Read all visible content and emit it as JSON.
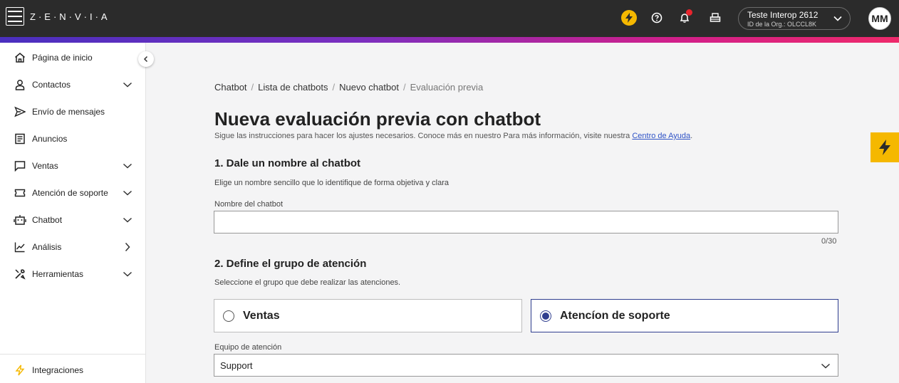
{
  "brand": {
    "logo_text": "Z·E·N·V·I·A"
  },
  "header": {
    "org_name": "Teste Interop 2612",
    "org_id": "ID de la Org.: OLCCL8K",
    "avatar_initials": "MM",
    "icons": [
      "bolt-icon",
      "help-icon",
      "bell-icon",
      "inbox-icon",
      "chevron-down-icon"
    ],
    "accent": "#f5b800",
    "notif_color": "#e8242d"
  },
  "sidebar": {
    "items": [
      {
        "label": "Página de inicio",
        "icon": "home-icon",
        "chevron": ""
      },
      {
        "label": "Contactos",
        "icon": "person-icon",
        "chevron": "down"
      },
      {
        "label": "Envío de mensajes",
        "icon": "send-icon",
        "chevron": ""
      },
      {
        "label": "Anuncios",
        "icon": "megaphone-icon",
        "chevron": ""
      },
      {
        "label": "Ventas",
        "icon": "chat-icon",
        "chevron": "down"
      },
      {
        "label": "Atención de soporte",
        "icon": "ticket-icon",
        "chevron": "down"
      },
      {
        "label": "Chatbot",
        "icon": "robot-icon",
        "chevron": "down"
      },
      {
        "label": "Análisis",
        "icon": "chart-icon",
        "chevron": "right"
      },
      {
        "label": "Herramientas",
        "icon": "tools-icon",
        "chevron": "down"
      }
    ],
    "footer_item": {
      "label": "Integraciones",
      "icon": "bolt-icon"
    }
  },
  "breadcrumb": [
    "Chatbot",
    "Lista de chatbots",
    "Nuevo chatbot",
    "Evaluación previa"
  ],
  "page": {
    "title": "Nueva evaluación previa con chatbot",
    "subtitle": "Sigue las instrucciones para hacer los ajustes necesarios. Conoce más en nuestro Para más información, visite nuestra",
    "help_link": "Centro de Ayuda",
    "subtitle_end": "."
  },
  "section1": {
    "title": "1. Dale un nombre al chatbot",
    "description": "Elige un nombre sencillo que lo identifique de forma objetiva y clara",
    "field_label": "Nombre del chatbot",
    "field_value": "",
    "counter": "0/30"
  },
  "section2": {
    "title": "2. Define el grupo de atención",
    "description": "Seleccione el grupo que debe realizar las atenciones.",
    "options": [
      "Ventas",
      "Atencíon de soporte"
    ],
    "selected": "Atencíon de soporte",
    "team_label": "Equipo de atención",
    "team_value": "Support"
  }
}
